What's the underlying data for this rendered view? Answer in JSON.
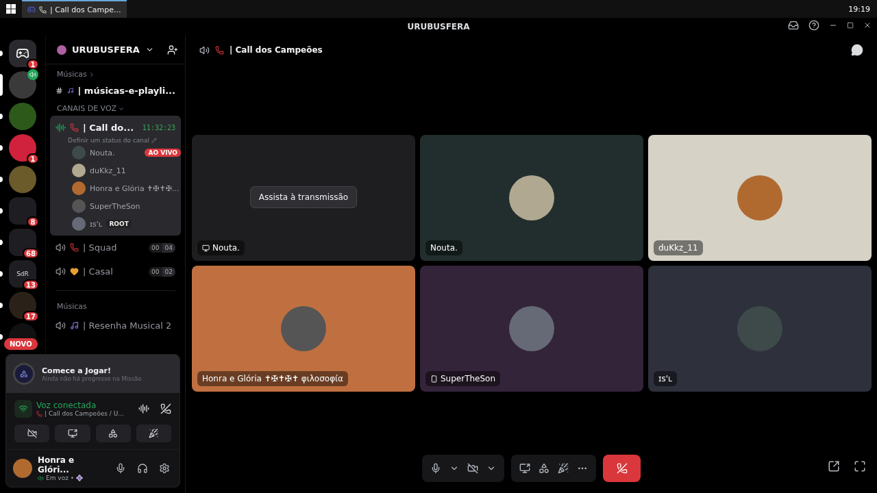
{
  "taskbar": {
    "tab_title": "| Call dos Campe...",
    "clock": "19:19"
  },
  "titlebar": {
    "title": "URUBUSFERA"
  },
  "servers": [
    {
      "kind": "home",
      "badge": "1",
      "selected": false
    },
    {
      "kind": "server",
      "selected": true,
      "speaking": true
    },
    {
      "kind": "server",
      "selected": false
    },
    {
      "kind": "server",
      "badge": "1",
      "selected": false
    },
    {
      "kind": "server",
      "selected": false
    },
    {
      "kind": "folder",
      "badge": "8",
      "selected": false
    },
    {
      "kind": "folder",
      "badge": "68",
      "selected": false
    },
    {
      "kind": "folder",
      "badge": "13",
      "label": "SdR",
      "selected": false
    },
    {
      "kind": "server",
      "badge": "17",
      "selected": false
    },
    {
      "kind": "server",
      "selected": false
    }
  ],
  "novo_badge": "NOVO",
  "sidebar": {
    "server_name": "URUBUSFERA",
    "items": [
      {
        "kind": "category",
        "label": "Músicas",
        "expanded": false
      },
      {
        "kind": "text",
        "name": "| músicas-e-playli...",
        "emoji": {
          "kind": "music"
        },
        "unread": true
      },
      {
        "kind": "category",
        "label": "CANAIS DE VOZ",
        "expanded": true
      },
      {
        "kind": "voice",
        "name": "| Call do...",
        "emoji": {
          "kind": "phone"
        },
        "selected": true,
        "timer": "11:32:23",
        "status": "Definir um status do canal",
        "members": [
          {
            "name": "Nouta.",
            "live": "AO VIVO"
          },
          {
            "name": "duKkz_11"
          },
          {
            "name": "Honra e Glória ✝✠✝✠..."
          },
          {
            "name": "SuperTheSon"
          },
          {
            "name": "ɪs'ʟ",
            "tag": "ROOT"
          }
        ]
      },
      {
        "kind": "voice",
        "name": "| Squad",
        "emoji": {
          "kind": "phone"
        },
        "selected": false,
        "count": "00",
        "limit": "04"
      },
      {
        "kind": "voice",
        "name": "| Casal",
        "emoji": {
          "kind": "hearts"
        },
        "selected": false,
        "count": "00",
        "limit": "02"
      },
      {
        "kind": "divider"
      },
      {
        "kind": "category_plain",
        "label": "Músicas"
      },
      {
        "kind": "voice",
        "name": "| Resenha Musical 2",
        "emoji": {
          "kind": "music"
        },
        "selected": false
      }
    ]
  },
  "quest": {
    "title": "Comece a Jogar!",
    "subtitle": "Ainda não há progresso na Missão"
  },
  "voice_panel": {
    "status": "Voz conectada",
    "channel": "| Call dos Campeões / U...",
    "camera_on": false
  },
  "user": {
    "name": "Honra e Glóri...",
    "status": "Em voz •"
  },
  "channel_header": {
    "title": "| Call dos Campeões"
  },
  "tiles": [
    {
      "kind": "stream",
      "name": "Nouta.",
      "button": "Assista à transmissão",
      "color": "#1e1e20"
    },
    {
      "kind": "avatar",
      "name": "Nouta.",
      "color": "#222e2e"
    },
    {
      "kind": "avatar",
      "name": "duKkz_11",
      "color": "#d6d2c6"
    },
    {
      "kind": "avatar",
      "name": "Honra e Glória ✝✠✝✠✝ φιλοσοφία",
      "color": "#c07040"
    },
    {
      "kind": "mobile",
      "name": "SuperTheSon",
      "color": "#33243a"
    },
    {
      "kind": "avatar",
      "name": "ɪs'ʟ",
      "color": "#2e303c"
    }
  ]
}
